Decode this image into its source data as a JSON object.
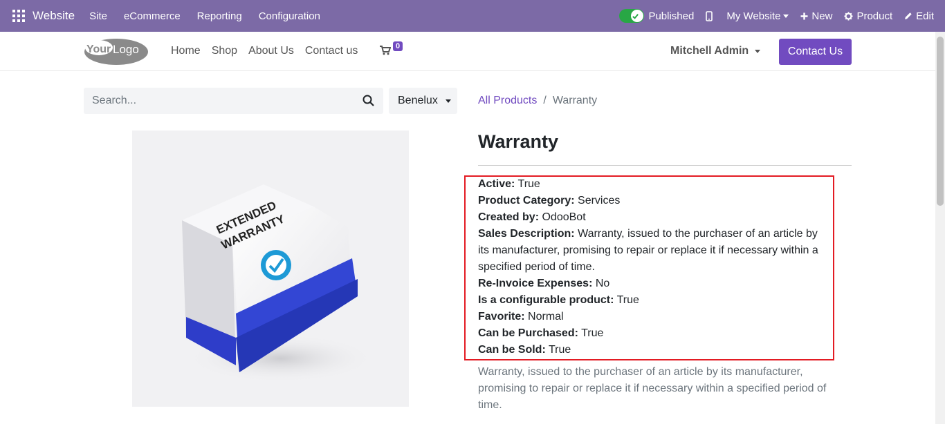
{
  "adminbar": {
    "app_name": "Website",
    "menu": [
      "Site",
      "eCommerce",
      "Reporting",
      "Configuration"
    ],
    "published_label": "Published",
    "my_website_label": "My Website",
    "new_label": "New",
    "product_label": "Product",
    "edit_label": "Edit"
  },
  "header": {
    "logo_text": "YourLogo",
    "nav": [
      "Home",
      "Shop",
      "About Us",
      "Contact us"
    ],
    "cart_count": "0",
    "user_name": "Mitchell Admin",
    "contact_button": "Contact Us"
  },
  "search": {
    "placeholder": "Search...",
    "pricelist": "Benelux"
  },
  "breadcrumb": {
    "link": "All Products",
    "separator": "/",
    "current": "Warranty"
  },
  "product": {
    "title": "Warranty",
    "image_text": "EXTENDED WARRANTY",
    "attributes": [
      {
        "label": "Active:",
        "value": "True"
      },
      {
        "label": "Product Category:",
        "value": "Services"
      },
      {
        "label": "Created by:",
        "value": "OdooBot"
      },
      {
        "label": "Sales Description:",
        "value": "Warranty, issued to the purchaser of an article by its manufacturer, promising to repair or replace it if necessary within a specified period of time."
      },
      {
        "label": "Re-Invoice Expenses:",
        "value": "No"
      },
      {
        "label": "Is a configurable product:",
        "value": "True"
      },
      {
        "label": "Favorite:",
        "value": "Normal"
      },
      {
        "label": "Can be Purchased:",
        "value": "True"
      },
      {
        "label": "Can be Sold:",
        "value": "True"
      }
    ],
    "description": "Warranty, issued to the purchaser of an article by its manufacturer, promising to repair or replace it if necessary within a specified period of time."
  },
  "colors": {
    "admin_bar": "#7c6aa6",
    "primary": "#714bc0",
    "published_green": "#28a745",
    "highlight_border": "#e31b23"
  }
}
